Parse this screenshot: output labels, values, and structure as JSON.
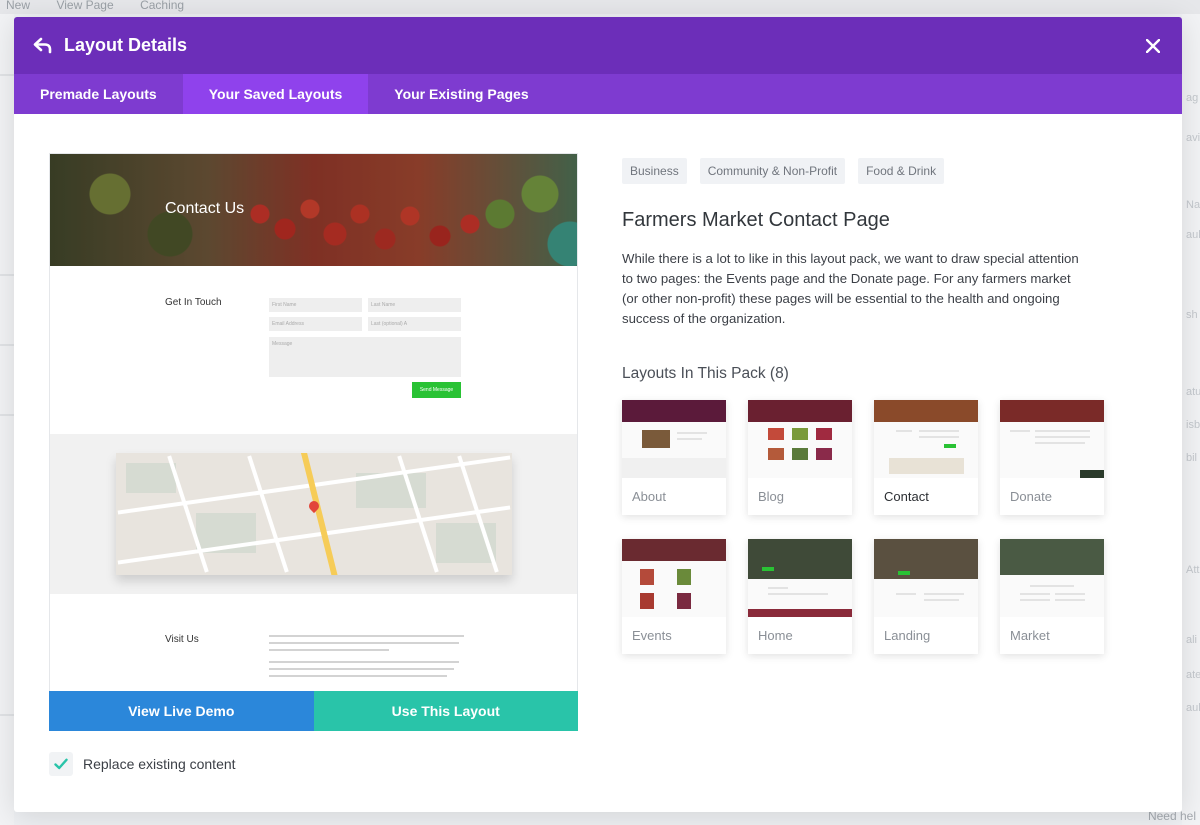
{
  "background": {
    "top_items": [
      "New",
      "View Page",
      "Caching"
    ],
    "right_fragments": [
      "ag",
      "avi",
      "Na",
      "ault",
      "sh",
      "atu",
      "isb",
      "bil",
      "Att",
      "ali",
      "ate",
      "ault"
    ],
    "bottom_note": "Need hel"
  },
  "modal": {
    "title": "Layout Details",
    "tabs": [
      {
        "label": "Premade Layouts",
        "active": false
      },
      {
        "label": "Your Saved Layouts",
        "active": true
      },
      {
        "label": "Your Existing Pages",
        "active": false
      }
    ]
  },
  "preview": {
    "hero_title": "Contact Us",
    "get_in_touch": "Get In Touch",
    "fields": {
      "first_name": "First Name",
      "last_name": "Last Name",
      "email": "Email Address",
      "last": "Last (optional) A",
      "message": "Message"
    },
    "send_button": "Send Message",
    "visit_us": "Visit Us"
  },
  "actions": {
    "view_demo": "View Live Demo",
    "use_layout": "Use This Layout",
    "replace_label": "Replace existing content",
    "replace_checked": true
  },
  "details": {
    "categories": [
      "Business",
      "Community & Non-Profit",
      "Food & Drink"
    ],
    "title": "Farmers Market Contact Page",
    "description": "While there is a lot to like in this layout pack, we want to draw special attention to two pages: the Events page and the Donate page. For any farmers market (or other non-profit) these pages will be essential to the health and ongoing success of the organization.",
    "pack_title": "Layouts In This Pack (8)",
    "layouts": [
      {
        "label": "About",
        "active": false,
        "header_color": "#5b1a3a"
      },
      {
        "label": "Blog",
        "active": false,
        "header_color": "#6a2030"
      },
      {
        "label": "Contact",
        "active": true,
        "header_color": "#8a4a2a"
      },
      {
        "label": "Donate",
        "active": false,
        "header_color": "#7a2a28"
      },
      {
        "label": "Events",
        "active": false,
        "header_color": "#6a2a30"
      },
      {
        "label": "Home",
        "active": false,
        "header_color": "#3f4a38"
      },
      {
        "label": "Landing",
        "active": false,
        "header_color": "#5a5040"
      },
      {
        "label": "Market",
        "active": false,
        "header_color": "#4a5a44"
      }
    ]
  },
  "colors": {
    "header": "#6c2eb9",
    "tabs": "#7e3bd0",
    "tab_active": "#8f42ec",
    "demo_button": "#2b87da",
    "use_button": "#29c4a9",
    "send_button": "#29c234"
  }
}
